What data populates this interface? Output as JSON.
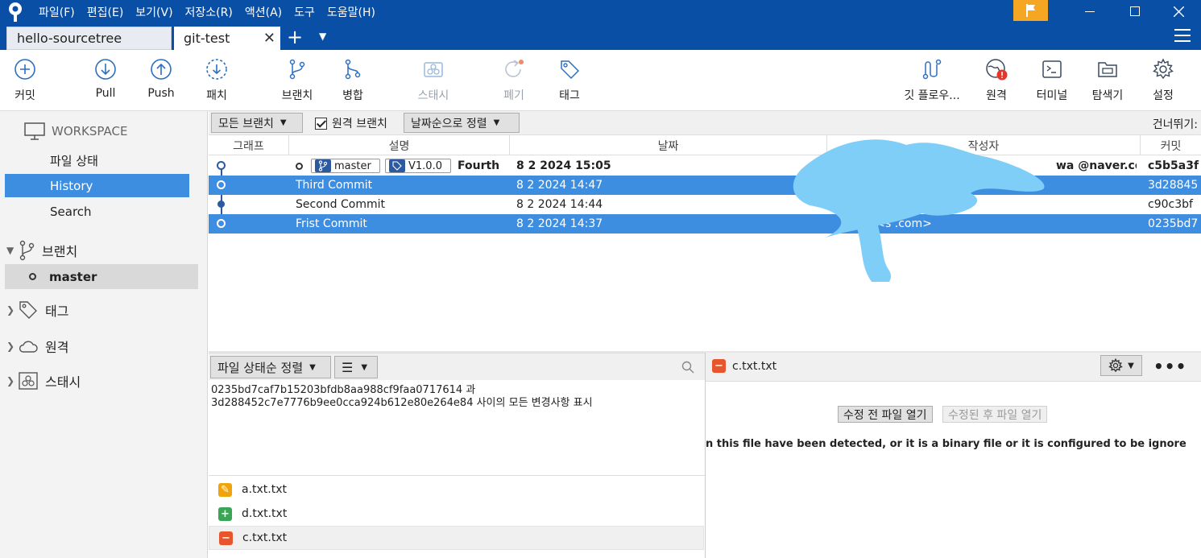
{
  "menu": [
    "파일(F)",
    "편집(E)",
    "보기(V)",
    "저장소(R)",
    "액션(A)",
    "도구",
    "도움말(H)"
  ],
  "tabs": {
    "inactive": "hello-sourcetree",
    "active": "git-test",
    "add_symbol": "+"
  },
  "toolbar": {
    "commit": "커밋",
    "pull": "Pull",
    "push": "Push",
    "patch": "패치",
    "branch": "브랜치",
    "merge": "병합",
    "stash": "스태시",
    "discard": "폐기",
    "tag": "태그",
    "git_flow": "깃 플로우...",
    "remote": "원격",
    "terminal": "터미널",
    "explorer": "탐색기",
    "settings": "설정"
  },
  "sidebar": {
    "workspace": "WORKSPACE",
    "items": [
      "파일 상태",
      "History",
      "Search"
    ],
    "selected_item": "History",
    "branches_label": "브랜치",
    "current_branch": "master",
    "tags_label": "태그",
    "remotes_label": "원격",
    "stashes_label": "스태시"
  },
  "filter": {
    "branches": "모든 브랜치",
    "remote_branches": "원격 브랜치",
    "remote_checked": true,
    "sort": "날짜순으로 정렬",
    "skip": "건너뛰기:"
  },
  "columns": {
    "graph": "그래프",
    "description": "설명",
    "date": "날짜",
    "author": "작성자",
    "commit": "커밋"
  },
  "commits": [
    {
      "description": "Fourth",
      "branch_chip": "master",
      "tag_chip": "V1.0.0",
      "date": "8 2 2024 15:05",
      "author": "wa @naver.com>",
      "hash": "c5b5a3f",
      "bold": true,
      "selected": false
    },
    {
      "description": "Third Commit",
      "date": "8 2 2024 14:47",
      "author": "",
      "hash": "3d28845",
      "bold": false,
      "selected": true
    },
    {
      "description": "Second Commit",
      "date": "8 2 2024 14:44",
      "author": "",
      "hash": "c90c3bf",
      "bold": false,
      "selected": false
    },
    {
      "description": "Frist Commit",
      "date": "8 2 2024 14:37",
      "author": "gh m <s .com>",
      "hash": "0235bd7",
      "bold": false,
      "selected": true
    }
  ],
  "lower_left": {
    "sort": "파일 상태순 정렬",
    "view_mode": "☰",
    "description_line1": "0235bd7caf7b15203bfdb8aa988cf9faa0717614 과",
    "description_line2": "3d288452c7e7776b9ee0cca924b612e80e264e84 사이의 모든 변경사항 표시",
    "files": [
      {
        "name": "a.txt.txt",
        "status": "modified",
        "color": "#f0a30a",
        "symbol": "✎"
      },
      {
        "name": "d.txt.txt",
        "status": "added",
        "color": "#3aa655",
        "symbol": "+"
      },
      {
        "name": "c.txt.txt",
        "status": "removed",
        "color": "#e8552d",
        "symbol": "−"
      }
    ]
  },
  "lower_right": {
    "file": "c.txt.txt",
    "open_before": "수정 전 파일 열기",
    "open_after": "수정된 후 파일 열기",
    "message": "n this file have been detected, or it is a binary file or it is configured to be ignored by the"
  },
  "colors": {
    "titlebar": "#0a4fa6",
    "selection": "#3d8ee0",
    "flag": "#f5a623"
  }
}
